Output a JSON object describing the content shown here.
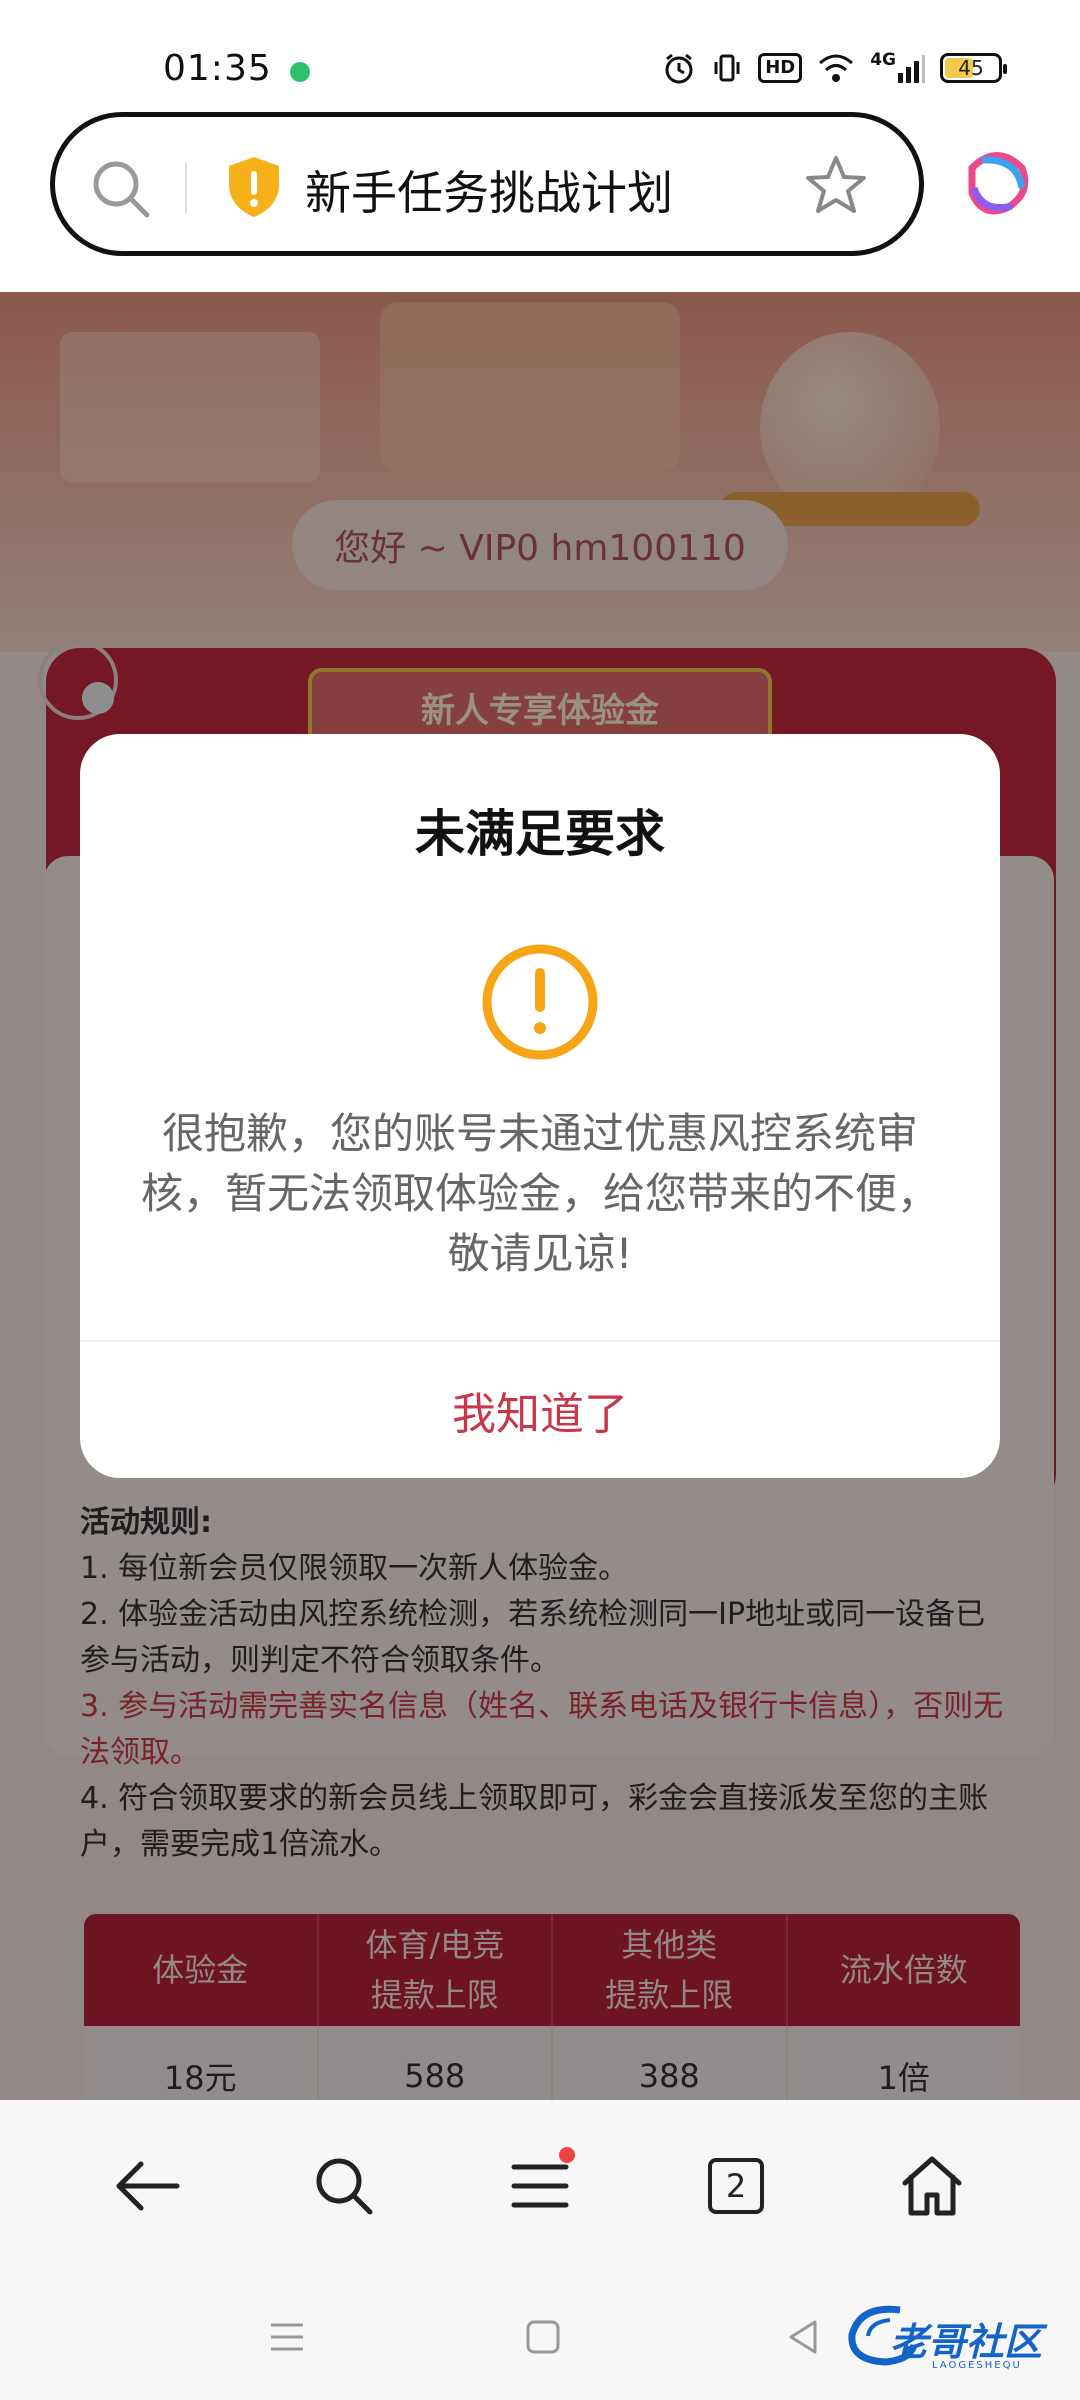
{
  "status_bar": {
    "time": "01:35",
    "hd_label": "HD",
    "network_label": "4G",
    "battery": "45"
  },
  "address_bar": {
    "title": "新手任务挑战计划"
  },
  "page": {
    "greeting": "您好 ~ VIP0 hm100110",
    "ribbon_title": "新人专享体验金",
    "rules": {
      "title": "活动规则:",
      "items": [
        "1. 每位新会员仅限领取一次新人体验金。",
        "2. 体验金活动由风控系统检测，若系统检测同一IP地址或同一设备已参与活动，则判定不符合领取条件。",
        "3. 参与活动需完善实名信息（姓名、联系电话及银行卡信息），否则无法领取。",
        "4. 符合领取要求的新会员线上领取即可，彩金会直接派发至您的主账户，需要完成1倍流水。"
      ]
    },
    "table": {
      "headers": [
        "体验金",
        "体育/电竞\n提款上限",
        "其他类\n提款上限",
        "流水倍数"
      ],
      "rows": [
        [
          "18元",
          "588",
          "388",
          "1倍"
        ]
      ]
    }
  },
  "dialog": {
    "title": "未满足要求",
    "message": "很抱歉，您的账号未通过优惠风控系统审核，暂无法领取体验金，给您带来的不便，敬请见谅!",
    "button": "我知道了"
  },
  "toolbar": {
    "tabs_count": "2"
  },
  "watermark": {
    "text": "老哥社区",
    "sub": "LAOGESHEQU"
  },
  "colors": {
    "accent_red": "#c8364a",
    "warning_orange": "#f5a516",
    "card_red": "#c2283f"
  }
}
